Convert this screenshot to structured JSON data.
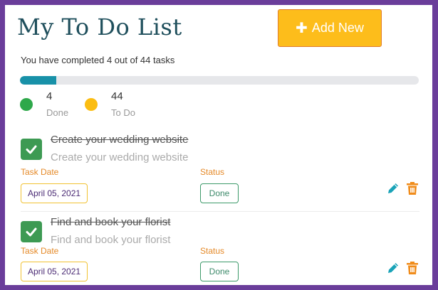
{
  "header": {
    "title": "My To Do List",
    "add_button_label": "Add New",
    "add_button_icon": "plus-icon"
  },
  "summary": {
    "text": "You have completed 4 out of 44 tasks",
    "progress_fraction": 0.0909
  },
  "stats": {
    "done": {
      "value": "4",
      "label": "Done",
      "color": "#2ea84a"
    },
    "todo": {
      "value": "44",
      "label": "To Do",
      "color": "#fbbd12"
    }
  },
  "tasks": [
    {
      "name": "Create your wedding website",
      "description": "Create your wedding website",
      "date_label": "Task Date",
      "date": "April 05, 2021",
      "status_label": "Status",
      "status": "Done",
      "completed": true
    },
    {
      "name": "Find and book your florist",
      "description": "Find and book your florist",
      "date_label": "Task Date",
      "date": "April 05, 2021",
      "status_label": "Status",
      "status": "Done",
      "completed": true
    }
  ],
  "colors": {
    "frame": "#6a3d9a",
    "accent_teal": "#1891a8",
    "add_button": "#fdbd1b",
    "check_green": "#3d9a53",
    "edit_icon": "#1aa3b8",
    "trash_icon": "#f08c1b"
  }
}
